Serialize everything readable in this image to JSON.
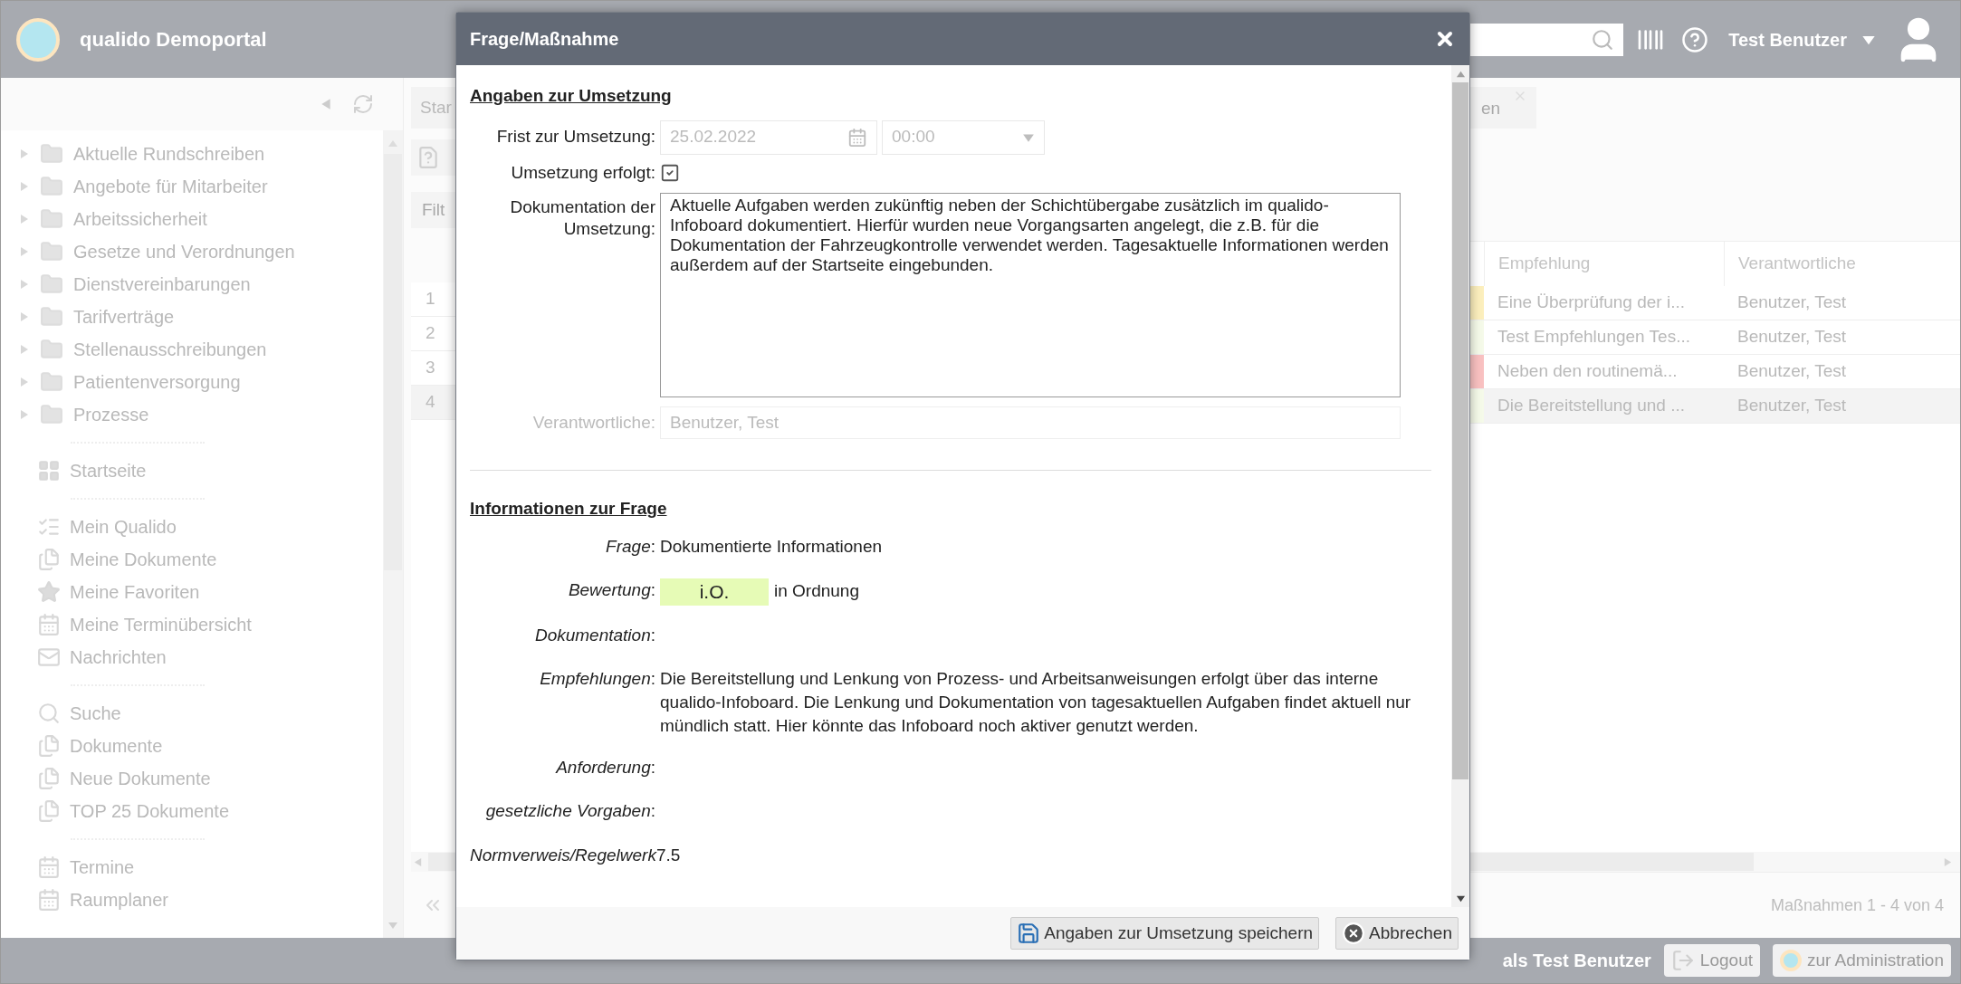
{
  "header": {
    "brand": "qualido Demoportal",
    "user": "Test Benutzer"
  },
  "sidebar": {
    "tree": [
      {
        "label": "Aktuelle Rundschreiben"
      },
      {
        "label": "Angebote für Mitarbeiter"
      },
      {
        "label": "Arbeitssicherheit"
      },
      {
        "label": "Gesetze und Verordnungen"
      },
      {
        "label": "Dienstvereinbarungen"
      },
      {
        "label": "Tarifverträge"
      },
      {
        "label": "Stellenausschreibungen"
      },
      {
        "label": "Patientenversorgung"
      },
      {
        "label": "Prozesse"
      }
    ],
    "sections": [
      [
        {
          "label": "Startseite",
          "kind": "grid"
        }
      ],
      [
        {
          "label": "Mein Qualido",
          "kind": "checks"
        },
        {
          "label": "Meine Dokumente",
          "kind": "docs"
        },
        {
          "label": "Meine Favoriten",
          "kind": "star"
        },
        {
          "label": "Meine Terminübersicht",
          "kind": "calendar"
        },
        {
          "label": "Nachrichten",
          "kind": "mail"
        }
      ],
      [
        {
          "label": "Suche",
          "kind": "search"
        },
        {
          "label": "Dokumente",
          "kind": "docs"
        },
        {
          "label": "Neue Dokumente",
          "kind": "docs"
        },
        {
          "label": "TOP 25 Dokumente",
          "kind": "docs"
        }
      ],
      [
        {
          "label": "Termine",
          "kind": "calendar"
        },
        {
          "label": "Raumplaner",
          "kind": "calendar"
        }
      ]
    ]
  },
  "main": {
    "tab_left": "Star",
    "tab_right": "en",
    "filter": "Filt",
    "table": {
      "columns": [
        "Empfehlung",
        "Verantwortliche"
      ],
      "rows": [
        {
          "number": "1",
          "recommendation": "Eine Überprüfung der i...",
          "responsible": "Benutzer, Test",
          "color": "#fcefbd",
          "selected": false
        },
        {
          "number": "2",
          "recommendation": "Test Empfehlungen Tes...",
          "responsible": "Benutzer, Test",
          "color": "#f5fae9",
          "selected": false
        },
        {
          "number": "3",
          "recommendation": "Neben den routinemä...",
          "responsible": "Benutzer, Test",
          "color": "#f9c1c1",
          "selected": false
        },
        {
          "number": "4",
          "recommendation": "Die Bereitstellung und ...",
          "responsible": "Benutzer, Test",
          "color": "#f5fae9",
          "selected": true
        }
      ]
    },
    "pagination": "Maßnahmen 1 - 4 von 4"
  },
  "footer": {
    "login": "als Test Benutzer",
    "buttons": [
      {
        "label": "Logout",
        "kind": "logout"
      },
      {
        "label": "zur Administration",
        "kind": "admin"
      }
    ]
  },
  "dialog": {
    "title": "Frage/Maßnahme",
    "implementation": {
      "heading": "Angaben zur Umsetzung",
      "deadline": {
        "label": "Frist zur Umsetzung:",
        "date": "25.02.2022",
        "time": "00:00"
      },
      "done": {
        "label": "Umsetzung erfolgt:",
        "checked": true
      },
      "documentation": {
        "label": "Dokumentation der Umsetzung:",
        "value": "Aktuelle Aufgaben werden zukünftig neben der Schichtübergabe zusätzlich im qualido-Infoboard dokumentiert. Hierfür wurden neue Vorgangsarten angelegt, die z.B. für die Dokumentation der Fahrzeugkontrolle verwendet werden. Tagesaktuelle Informationen werden außerdem auf der Startseite eingebunden."
      },
      "responsible": {
        "label": "Verantwortliche:",
        "value": "Benutzer, Test",
        "disabled": true
      }
    },
    "info": {
      "heading": "Informationen zur Frage",
      "fields": [
        {
          "kind": "text",
          "label": "*Frage*:",
          "value": "Dokumentierte Informationen"
        },
        {
          "kind": "rating",
          "label": "*Bewertung*:",
          "badge": "i.O.",
          "value": "in Ordnung"
        },
        {
          "kind": "text",
          "label": "*Dokumentation*:"
        },
        {
          "kind": "text",
          "label": "*Empfehlungen*:",
          "value": "Die Bereitstellung und Lenkung von Prozess- und Arbeitsanweisungen erfolgt über das interne qualido-Infoboard. Die Lenkung und Dokumentation von tagesaktuellen Aufgaben findet aktuell nur mündlich statt. Hier könnte das Infoboard noch aktiver genutzt werden."
        },
        {
          "kind": "text",
          "label": "*Anforderung*:"
        },
        {
          "kind": "text",
          "label": "*gesetzliche Vorgaben*:"
        },
        {
          "kind": "inline",
          "label": "*Normverweis/Regelwerk*",
          "value": "7.5"
        }
      ]
    },
    "buttons": [
      {
        "kind": "save",
        "label": "Angaben zur Umsetzung speichern"
      },
      {
        "kind": "cancel",
        "label": "Abbrechen"
      }
    ]
  }
}
